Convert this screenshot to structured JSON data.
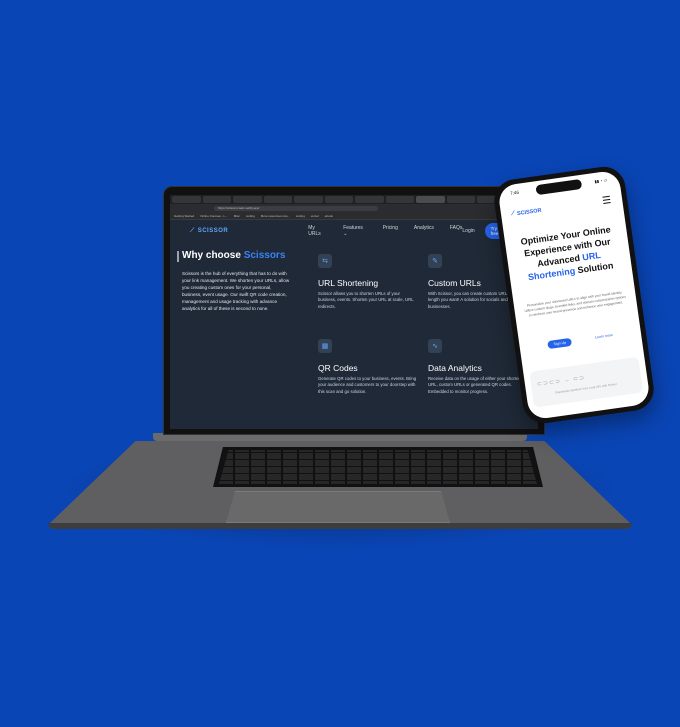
{
  "laptop": {
    "url": "https://scissorsmain.netlify.app/",
    "bookmarks": [
      "Getting Started",
      "Online Courses - L...",
      "Misc",
      "coding",
      "More resources tuto...",
      "coding",
      "vercel",
      "ebook"
    ],
    "nav": {
      "logo": "SCISSOR",
      "links": [
        "My URLs",
        "Features",
        "Pricing",
        "Analytics",
        "FAQs"
      ],
      "login": "Login",
      "cta": "Try for free"
    },
    "why": {
      "title_pre": "Why choose ",
      "title_hl": "Scissors",
      "text": "Scissors is the hub of everything that has to do with your link management. We shorten your URLs, allow you creating custom ones for your personal, business, event usage. Our swift QR code creation, management and usage tracking with advance analytics for all of these is second to none."
    },
    "features": [
      {
        "icon": "link-icon",
        "title": "URL Shortening",
        "desc": "Scissor allows you to shorten URLs of your business, events. Shorten your URL at scale, URL redirects."
      },
      {
        "icon": "edit-icon",
        "title": "Custom URLs",
        "desc": "With Scissor, you can create custom URLs, with the length you want! A solution for socials and businesses."
      },
      {
        "icon": "qr-icon",
        "title": "QR Codes",
        "desc": "Generate QR codes to your business, events. Bring your audience and customers to your doorstep with this scan and go solution."
      },
      {
        "icon": "analytics-icon",
        "title": "Data Analytics",
        "desc": "Receive data on the usage of either your shortened URL, custom URLs or generated QR codes. Embedded to monitor progress."
      }
    ]
  },
  "phone": {
    "time": "7:46",
    "status": "▮▮ ◔ ▭",
    "logo": "SCISSOR",
    "headline_1": "Optimize Your Online Experience with Our Advanced",
    "headline_hl": "URL Shortening",
    "headline_2": "Solution",
    "desc": "Personalize your shortened URLs to align with your brand identity. Utilize custom slugs, branded links, and domain customization options to reinforce your brand presence and enhance user engagement.",
    "cta": "Sign Up",
    "learn": "Learn more",
    "caption": "Seamlessly transform Your Long URL with Scissor"
  },
  "colors": {
    "background": "#0a45b5",
    "accent": "#2563eb",
    "screen": "#1f2937"
  }
}
